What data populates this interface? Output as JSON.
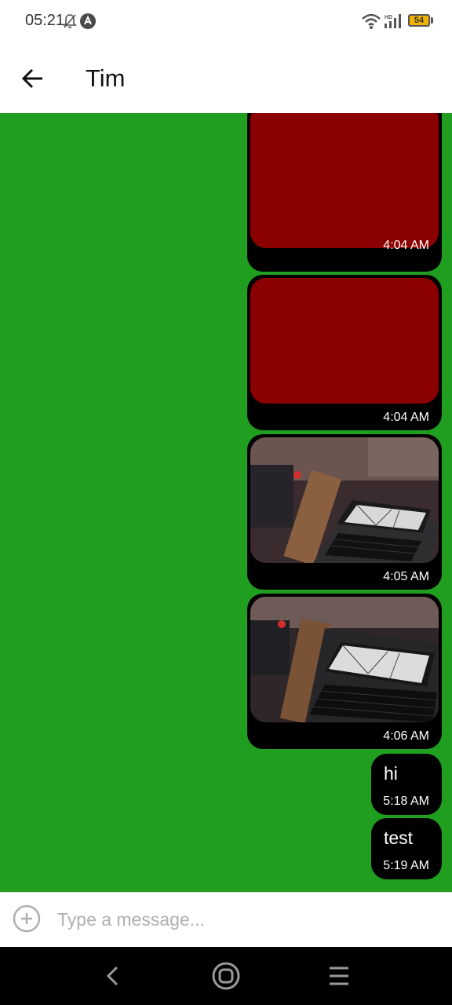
{
  "status_bar": {
    "time": "05:21",
    "battery": "54",
    "icons": [
      "bell-off-icon",
      "app-notification-icon",
      "wifi-icon",
      "hd-signal-icon",
      "battery-icon"
    ]
  },
  "header": {
    "title": "Tim",
    "back_icon": "arrow-left-icon"
  },
  "colors": {
    "chat_background": "#1f9e1f",
    "bubble": "#000000",
    "red_media": "#8b0000"
  },
  "messages": [
    {
      "type": "image",
      "media": "red-block",
      "time": "4:04 AM"
    },
    {
      "type": "image",
      "media": "red-block",
      "time": "4:04 AM"
    },
    {
      "type": "image",
      "media": "photo-laptop",
      "time": "4:05 AM"
    },
    {
      "type": "image",
      "media": "photo-laptop",
      "time": "4:06 AM"
    },
    {
      "type": "text",
      "text": "hi",
      "time": "5:18 AM"
    },
    {
      "type": "text",
      "text": "test",
      "time": "5:19 AM"
    }
  ],
  "composer": {
    "placeholder": "Type a message...",
    "value": "",
    "attach_icon": "plus-circle-icon"
  },
  "nav_bar": {
    "icons": [
      "nav-back-icon",
      "nav-home-icon",
      "nav-recents-icon"
    ]
  }
}
